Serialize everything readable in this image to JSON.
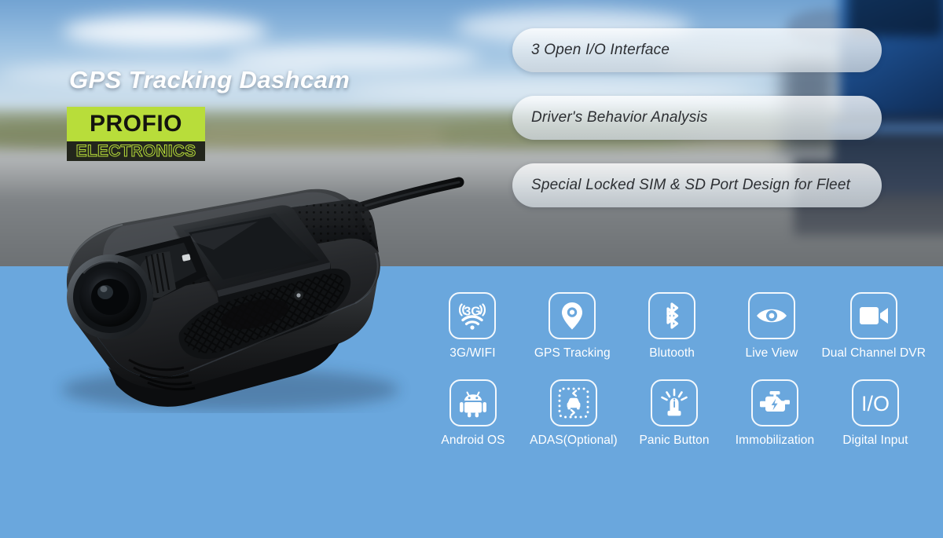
{
  "headline": "GPS Tracking Dashcam",
  "logo": {
    "word": "PROFIO",
    "sub": "ELECTRONICS",
    "green": "#b8dd3a",
    "dark": "#23261c"
  },
  "theme": {
    "panel_blue": "#6aa7dd",
    "pill_text": "#2d2f33",
    "icon_white": "#ffffff"
  },
  "features": [
    {
      "text": "3 Open I/O Interface"
    },
    {
      "text": "Driver's Behavior Analysis"
    },
    {
      "text": "Special Locked SIM & SD Port Design for Fleet"
    }
  ],
  "icon_rows": [
    [
      {
        "label": "3G/WIFI",
        "icon": "3g-wifi-icon"
      },
      {
        "label": "GPS Tracking",
        "icon": "map-pin-icon"
      },
      {
        "label": "Blutooth",
        "icon": "bluetooth-icon"
      },
      {
        "label": "Live View",
        "icon": "eye-icon"
      },
      {
        "label": "Dual Channel DVR",
        "icon": "video-camera-icon"
      }
    ],
    [
      {
        "label": "Android OS",
        "icon": "android-icon"
      },
      {
        "label": "ADAS(Optional)",
        "icon": "adas-car-icon"
      },
      {
        "label": "Panic Button",
        "icon": "siren-icon"
      },
      {
        "label": "Immobilization",
        "icon": "engine-bolt-icon"
      },
      {
        "label": "Digital Input",
        "icon": "io-text-icon"
      }
    ]
  ],
  "product": {
    "name": "GPS tracking dashcam device"
  }
}
